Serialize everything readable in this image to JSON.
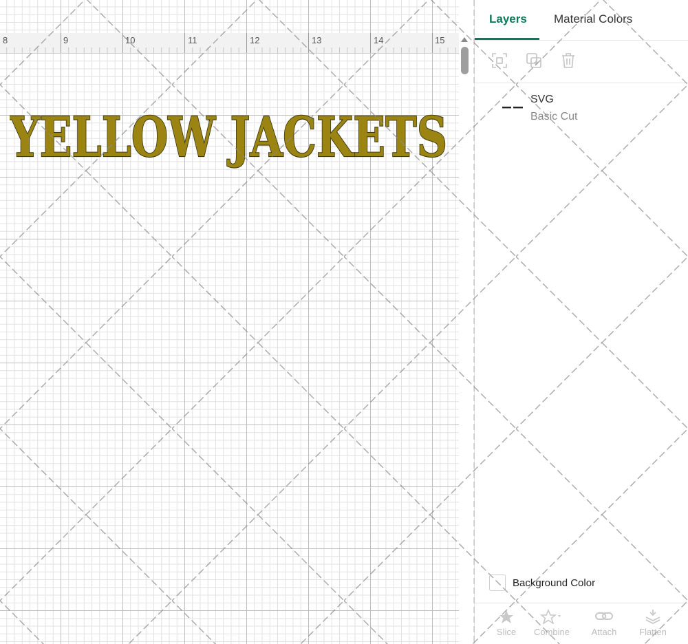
{
  "canvas": {
    "ruler_labels": [
      "8",
      "9",
      "10",
      "11",
      "12",
      "13",
      "14",
      "15"
    ],
    "artwork_text": "YELLOW JACKETS",
    "artwork_fill": "#9c8413",
    "artwork_stroke": "#3d3a10"
  },
  "panel": {
    "tabs": [
      {
        "label": "Layers",
        "active": true
      },
      {
        "label": "Material Colors",
        "active": false
      }
    ],
    "toolbar_icons": [
      "group-icon",
      "duplicate-icon",
      "delete-icon"
    ],
    "layer": {
      "name": "SVG",
      "operation": "Basic Cut"
    },
    "background_color_label": "Background Color",
    "bottom_tools": [
      {
        "label": "Slice",
        "icon": "slice-icon"
      },
      {
        "label": "Combine",
        "icon": "combine-icon"
      },
      {
        "label": "Attach",
        "icon": "attach-icon"
      },
      {
        "label": "Flatten",
        "icon": "flatten-icon"
      }
    ],
    "accent_color": "#0b7a5a"
  }
}
